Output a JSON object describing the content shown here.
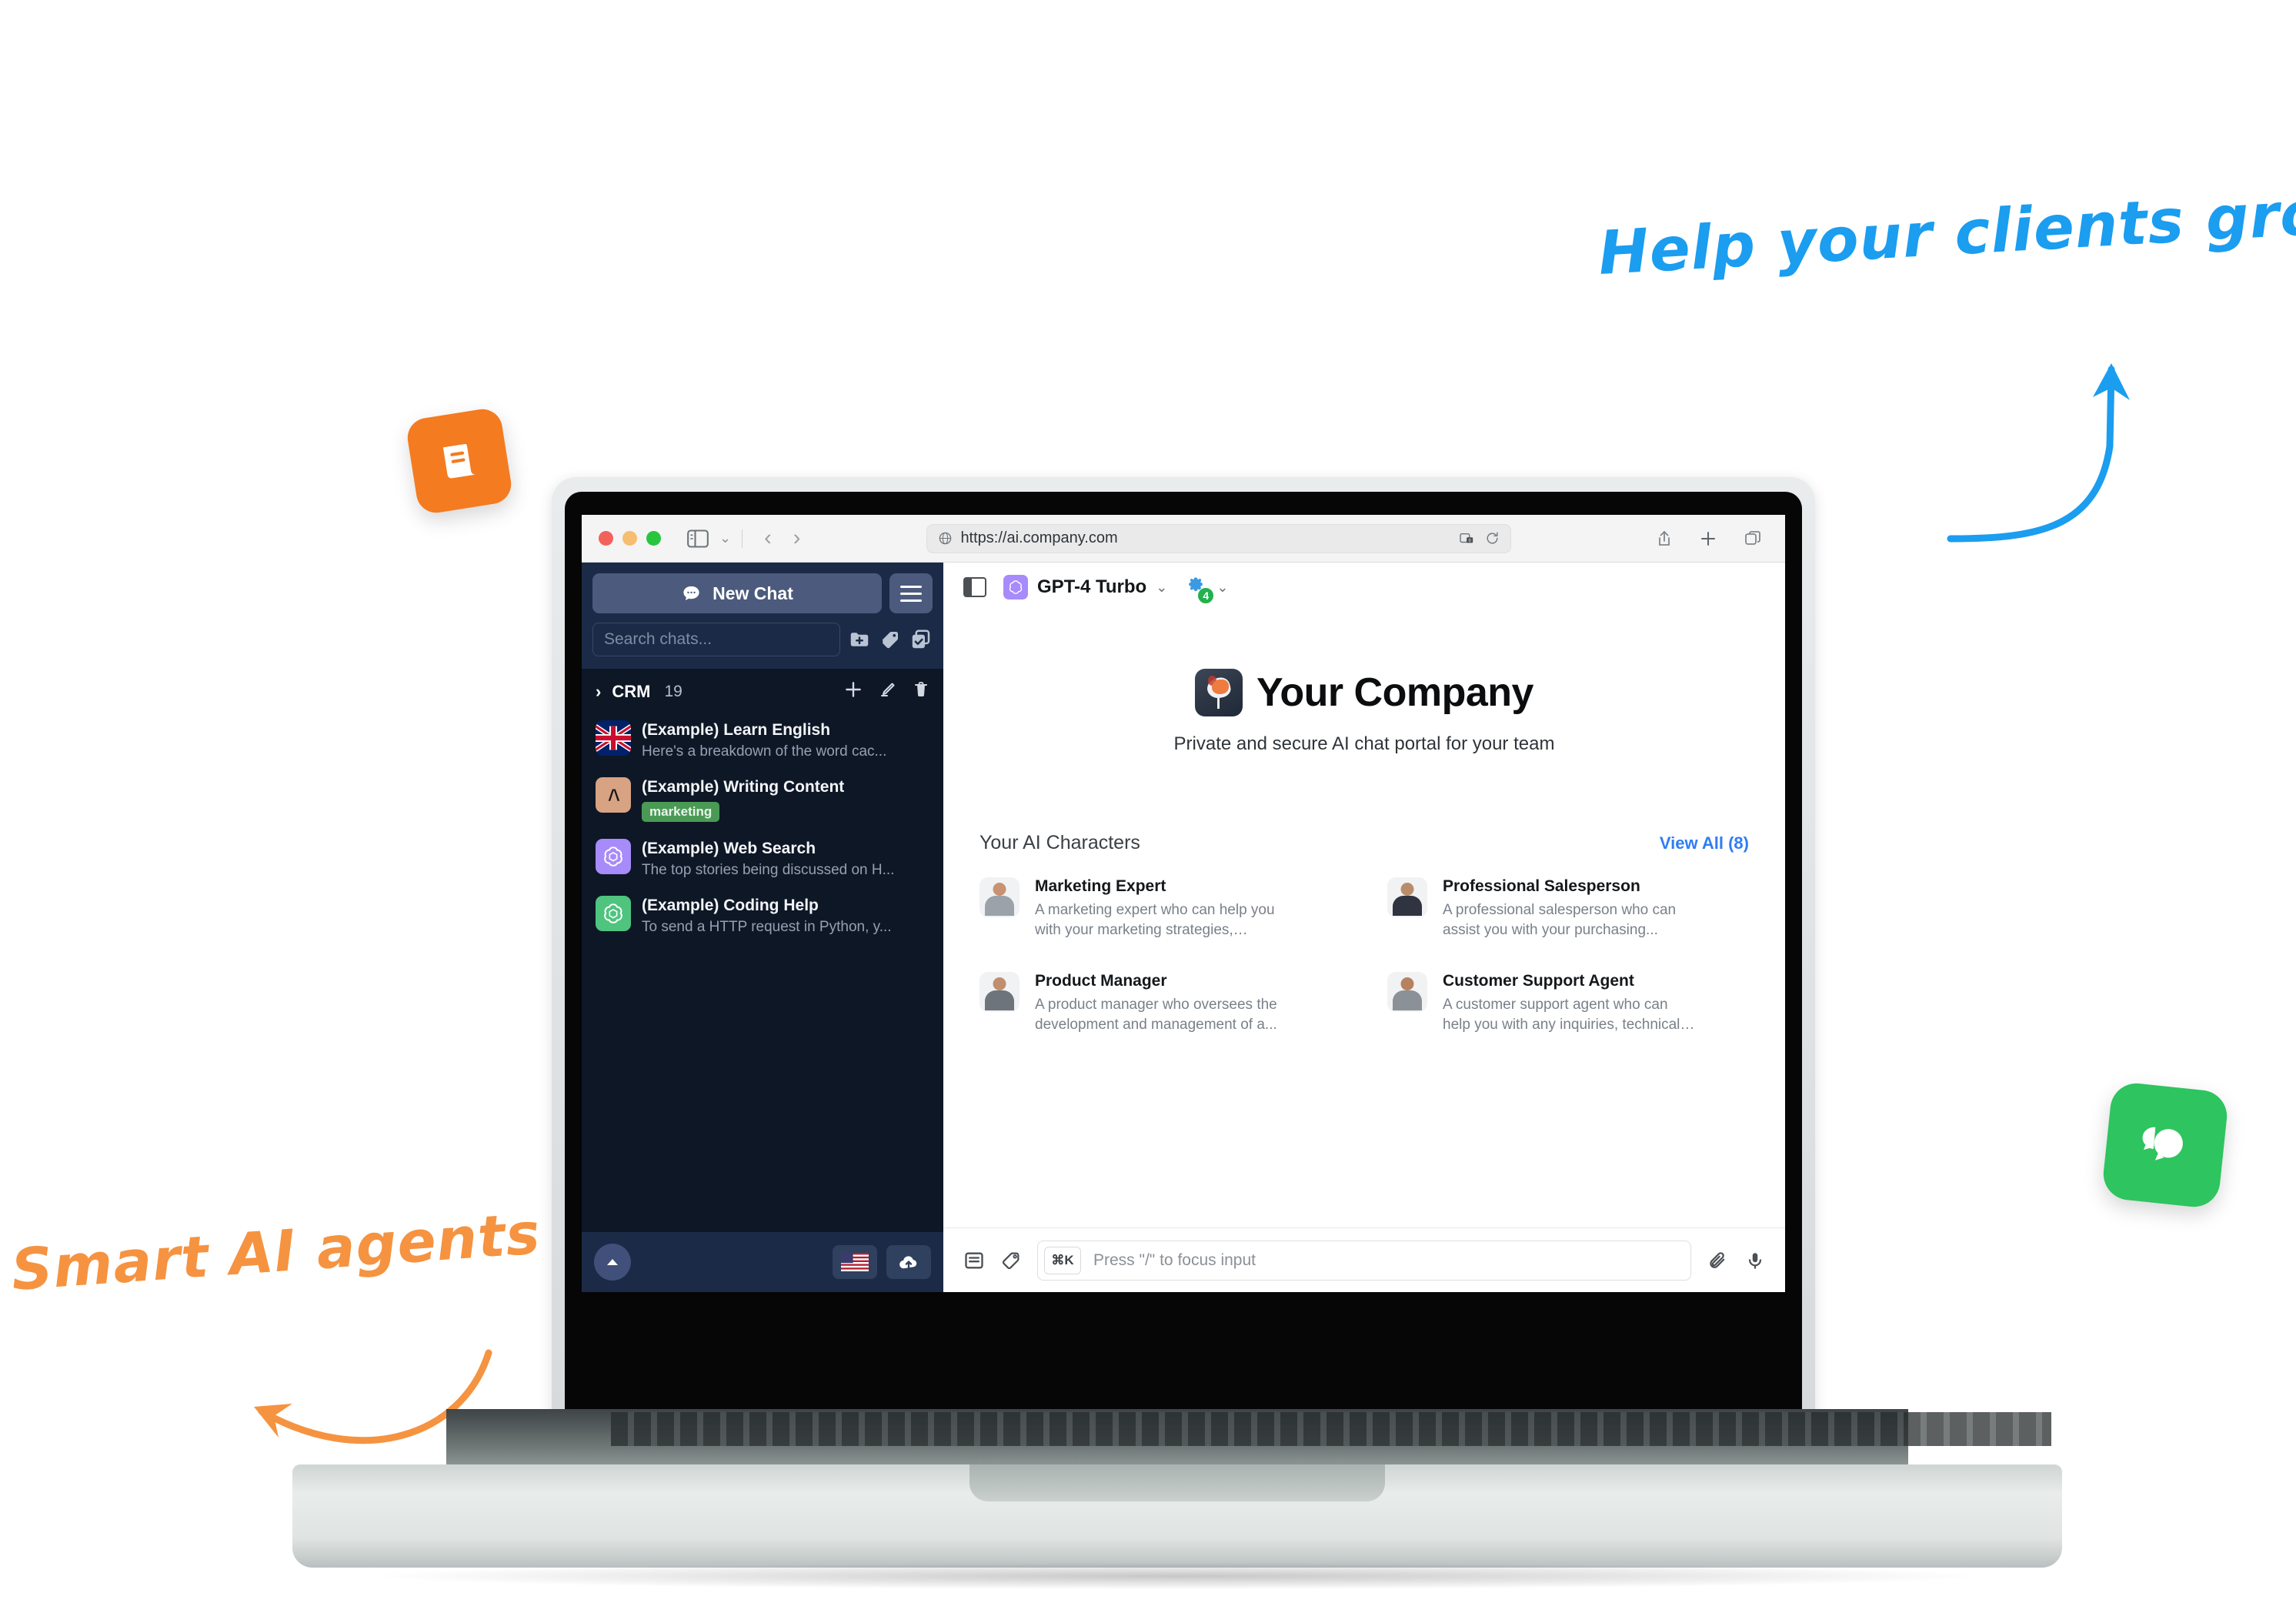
{
  "annotations": {
    "top_right": "Help your clients grow",
    "bottom_left": "Smart AI agents"
  },
  "badges": {
    "orange_icon": "article-icon",
    "green_icon": "chat-bubbles-icon"
  },
  "browser": {
    "traffic_lights": [
      "close",
      "minimize",
      "zoom"
    ],
    "sidebar_toggle_icon": "sidebar-toggle-icon",
    "back_arrow": "‹",
    "forward_arrow": "›",
    "url": "https://ai.company.com",
    "globe_icon": "globe-icon",
    "reader_icon": "reader-mode-icon",
    "reload_icon": "reload-icon",
    "share_icon": "share-icon",
    "new_tab_icon": "plus-icon",
    "tabs_icon": "tab-overview-icon"
  },
  "sidebar": {
    "new_chat_label": "New Chat",
    "new_chat_icon": "chat-bubble-icon",
    "menu_icon": "hamburger-icon",
    "search_placeholder": "Search chats...",
    "search_value": "",
    "tools": [
      {
        "name": "new-folder-icon"
      },
      {
        "name": "tag-icon"
      },
      {
        "name": "select-multiple-icon"
      }
    ],
    "folder": {
      "caret": "›",
      "name": "CRM",
      "count": "19",
      "actions": [
        "add-icon",
        "edit-icon",
        "delete-icon"
      ]
    },
    "chats": [
      {
        "title": "(Example) Learn English",
        "preview": "Here's a breakdown of the word cac...",
        "avatar": "uk-flag-icon",
        "tag": ""
      },
      {
        "title": "(Example) Writing Content",
        "preview": "",
        "avatar": "anthropic-icon",
        "tag": "marketing"
      },
      {
        "title": "(Example) Web Search",
        "preview": "The top stories being discussed on H...",
        "avatar": "openai-purple-icon",
        "tag": ""
      },
      {
        "title": "(Example) Coding Help",
        "preview": "To send a HTTP request in Python, y...",
        "avatar": "openai-green-icon",
        "tag": ""
      }
    ],
    "footer": {
      "collapse_icon": "chevron-up-icon",
      "language_icon": "us-flag-icon",
      "upload_icon": "cloud-upload-icon"
    }
  },
  "main": {
    "panel_toggle_icon": "panel-toggle-icon",
    "model": {
      "name": "GPT-4 Turbo",
      "avatar_icon": "openai-icon",
      "caret": "⌄"
    },
    "plugins": {
      "icon": "puzzle-piece-icon",
      "count": "4",
      "caret": "⌄"
    },
    "brand": {
      "logo_icon": "company-logo-icon",
      "title": "Your Company",
      "subtitle": "Private and secure AI chat portal for your team"
    },
    "characters_section": {
      "title": "Your AI Characters",
      "view_all": "View All (8)",
      "items": [
        {
          "name": "Marketing Expert",
          "description": "A marketing expert who can help you with your marketing strategies, market...",
          "avatar_icon": "person-avatar-icon",
          "skin": "#c99272",
          "outfit": "#9ba2a9"
        },
        {
          "name": "Professional Salesperson",
          "description": "A professional salesperson who can assist you with your purchasing...",
          "avatar_icon": "person-avatar-icon",
          "skin": "#b98d6b",
          "outfit": "#2f3440"
        },
        {
          "name": "Product Manager",
          "description": "A product manager who oversees the development and management of a...",
          "avatar_icon": "person-avatar-icon",
          "skin": "#c08f6d",
          "outfit": "#6e747b"
        },
        {
          "name": "Customer Support Agent",
          "description": "A customer support agent who can help you with any inquiries, technical issues...",
          "avatar_icon": "person-avatar-icon",
          "skin": "#b6825f",
          "outfit": "#8b9197"
        }
      ]
    },
    "composer": {
      "prompts_icon": "prompt-library-icon",
      "tag_icon": "tag-pen-icon",
      "shortcut_key": "⌘K",
      "placeholder": "Press \"/\" to focus input",
      "attach_icon": "paperclip-icon",
      "mic_icon": "microphone-icon"
    }
  },
  "colors": {
    "accent_blue": "#2f7df5",
    "sidebar_dark": "#0e1726",
    "sidebar_head": "#1b2a47",
    "button_blue": "#4c5a7d",
    "tag_green": "#4a9a55",
    "anno_blue": "#1b9df0",
    "anno_orange": "#f59341",
    "badge_orange": "#f47b20",
    "badge_green": "#2ec45f"
  }
}
